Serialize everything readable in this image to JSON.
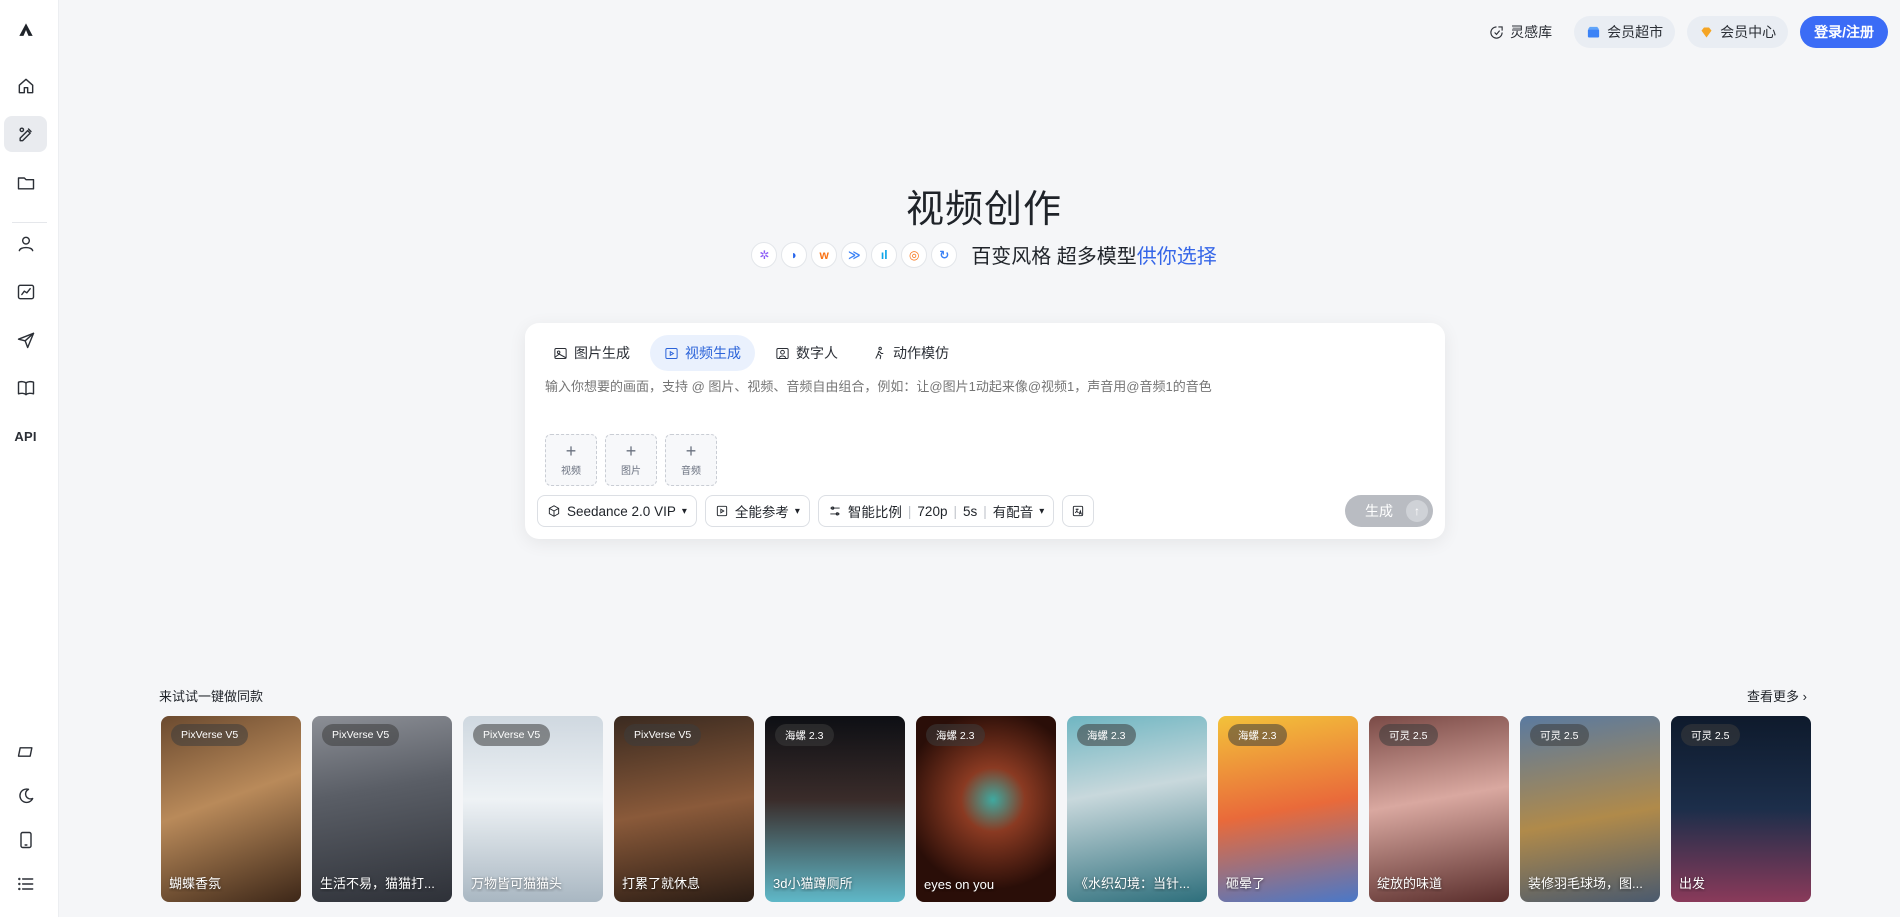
{
  "topbar": {
    "inspiration": "灵感库",
    "market": "会员超市",
    "member_center": "会员中心",
    "login": "登录/注册"
  },
  "hero": {
    "title": "视频创作",
    "subtitle_plain": "百变风格 超多模型",
    "subtitle_highlight": "供你选择"
  },
  "tabs": [
    {
      "label": "图片生成",
      "icon": "image-icon"
    },
    {
      "label": "视频生成",
      "icon": "video-icon"
    },
    {
      "label": "数字人",
      "icon": "digital-human-icon"
    },
    {
      "label": "动作模仿",
      "icon": "motion-icon"
    }
  ],
  "prompt": {
    "placeholder": "输入你想要的画面，支持 @ 图片、视频、音频自由组合，例如：让@图片1动起来像@视频1，声音用@音频1的音色"
  },
  "uploads": [
    "视频",
    "图片",
    "音频"
  ],
  "controls": {
    "model": "Seedance 2.0 VIP",
    "reference": "全能参考",
    "ratio": "智能比例",
    "resolution": "720p",
    "duration": "5s",
    "audio": "有配音",
    "generate": "生成"
  },
  "gallery": {
    "title": "来试试一键做同款",
    "more": "查看更多",
    "items": [
      {
        "badge": "PixVerse V5",
        "caption": "蝴蝶香氛",
        "bg": "linear-gradient(160deg,#6b4a2f 0%,#b98a5a 45%,#3d2718 100%)"
      },
      {
        "badge": "PixVerse V5",
        "caption": "生活不易，猫猫打...",
        "bg": "linear-gradient(170deg,#8c8f96 0%,#5a5e66 40%,#2e3138 100%)"
      },
      {
        "badge": "PixVerse V5",
        "caption": "万物皆可猫猫头",
        "bg": "linear-gradient(180deg,#cfd8e0 0%,#eef2f5 45%,#a9b7c2 100%)"
      },
      {
        "badge": "PixVerse V5",
        "caption": "打累了就休息",
        "bg": "linear-gradient(170deg,#3a2a20 0%,#8a5a3a 50%,#2a1c14 100%)"
      },
      {
        "badge": "海螺 2.3",
        "caption": "3d小猫蹲厕所",
        "bg": "linear-gradient(180deg,#0d0f14 0%,#3a2c2a 45%,#5fb8c8 100%)"
      },
      {
        "badge": "海螺 2.3",
        "caption": "eyes on you",
        "bg": "radial-gradient(circle at 55% 45%,#3fa9a0 0%,#8a3a22 25%,#2a0e08 70%)"
      },
      {
        "badge": "海螺 2.3",
        "caption": "《水织幻境：当针...",
        "bg": "linear-gradient(170deg,#6fb6c2 0%,#c8d8dc 40%,#2e6f7c 100%)"
      },
      {
        "badge": "海螺 2.3",
        "caption": "砸晕了",
        "bg": "linear-gradient(170deg,#f3c23a 0%,#e96a3a 50%,#4a78c8 100%)"
      },
      {
        "badge": "可灵 2.5",
        "caption": "绽放的味道",
        "bg": "linear-gradient(170deg,#7a4a46 0%,#d9a8a0 45%,#5a2e2c 100%)"
      },
      {
        "badge": "可灵 2.5",
        "caption": "装修羽毛球场，图...",
        "bg": "linear-gradient(170deg,#5a7aa0 0%,#b08a4a 55%,#4a5a6e 100%)"
      },
      {
        "badge": "可灵 2.5",
        "caption": "出发",
        "bg": "linear-gradient(180deg,#0e1a2c 0%,#1c2e4a 50%,#8a3a5a 100%)"
      }
    ]
  }
}
